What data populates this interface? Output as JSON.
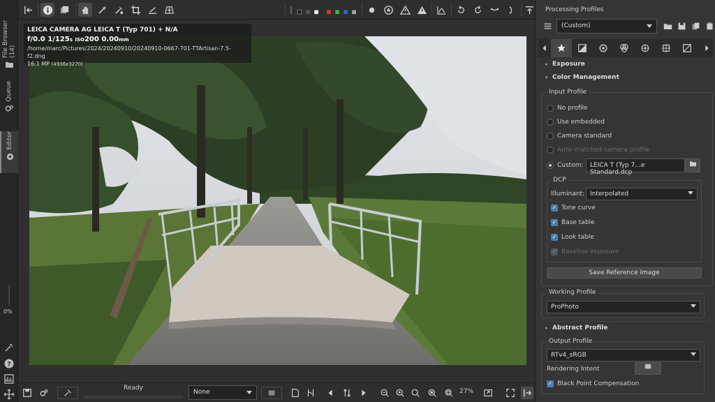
{
  "left_tabs": [
    {
      "label": "File Browser (14)"
    },
    {
      "label": "Queue"
    },
    {
      "label": "Editor"
    }
  ],
  "left_bottom": {
    "percent": "0%"
  },
  "image_info": {
    "camera": "LEICA CAMERA AG LEICA T (Typ 701) + N/A",
    "fnum": "f/0.0",
    "shutter": "1/125",
    "shutter_unit": "s",
    "iso_label": "ISO",
    "iso": "200",
    "focal": "0.00",
    "focal_unit": "mm",
    "path": "/home/marc/Pictures/2024/20240910/20240910-0667-701-TTArtisan-7.5-f2.dng",
    "megapixels": "16.1 MP",
    "dimensions": "(4936x3270)"
  },
  "bottom_bar": {
    "status": "Ready",
    "profile_select": "None",
    "zoom": "27%"
  },
  "right_panel": {
    "title": "Processing Profiles",
    "profile_value": "(Custom)",
    "sections": {
      "exposure": "Exposure",
      "color_management": "Color Management",
      "abstract_profile": "Abstract Profile"
    },
    "input_profile": {
      "title": "Input Profile",
      "options": [
        {
          "label": "No profile"
        },
        {
          "label": "Use embedded"
        },
        {
          "label": "Camera standard"
        },
        {
          "label": "Auto-matched camera profile"
        },
        {
          "label": "Custom:"
        }
      ],
      "custom_file": "LEICA T (Typ 7...e Standard.dcp"
    },
    "dcp": {
      "title": "DCP",
      "illuminant_label": "Illuminant:",
      "illuminant_value": "Interpolated",
      "checks": [
        {
          "label": "Tone curve"
        },
        {
          "label": "Base table"
        },
        {
          "label": "Look table"
        },
        {
          "label": "Baseline exposure"
        }
      ]
    },
    "save_reference_button": "Save Reference Image",
    "working_profile": {
      "title": "Working Profile",
      "value": "ProPhoto"
    },
    "output_profile": {
      "title": "Output Profile",
      "value": "RTv4_sRGB",
      "rendering_intent_label": "Rendering Intent",
      "black_point_label": "Black Point Compensation"
    }
  },
  "colors": {
    "accent": "#4a7fb0",
    "panel": "#353535",
    "toolbar": "#2e2e2e"
  }
}
